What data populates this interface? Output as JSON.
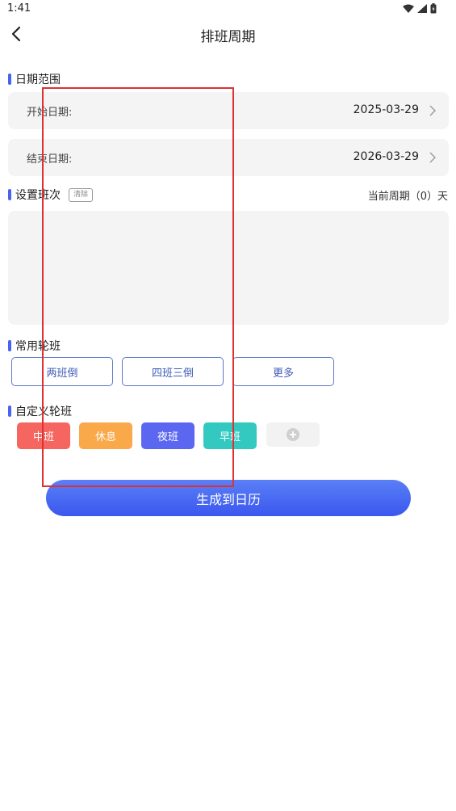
{
  "status_bar": {
    "time": "1:41"
  },
  "nav": {
    "title": "排班周期"
  },
  "date_range": {
    "title": "日期范围",
    "start_label": "开始日期:",
    "start_value": "2025-03-29",
    "end_label": "结束日期:",
    "end_value": "2026-03-29"
  },
  "shift_setup": {
    "title": "设置班次",
    "clear_label": "清除",
    "current_cycle": "当前周期（0）天"
  },
  "common_rotation": {
    "title": "常用轮班",
    "buttons": [
      "两班倒",
      "四班三倒",
      "更多"
    ]
  },
  "custom_rotation": {
    "title": "自定义轮班",
    "chips": [
      {
        "label": "中班",
        "color": "#f4665f"
      },
      {
        "label": "休息",
        "color": "#f9a84a"
      },
      {
        "label": "夜班",
        "color": "#5b67f0"
      },
      {
        "label": "早班",
        "color": "#33c9c1"
      }
    ]
  },
  "generate_label": "生成到日历",
  "colors": {
    "accent": "#4a62f0",
    "highlight_box": "#e03030"
  }
}
